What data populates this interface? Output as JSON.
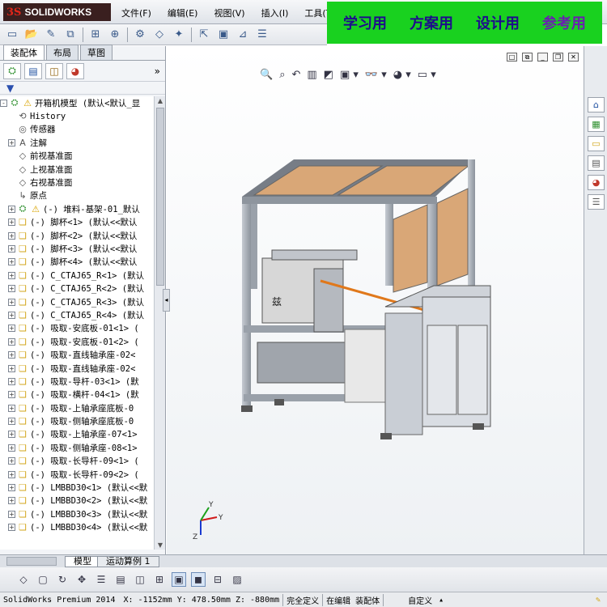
{
  "app": {
    "brand_mark": "3S",
    "brand_name": "SOLIDWORKS"
  },
  "menu": [
    "文件(F)",
    "编辑(E)",
    "视图(V)",
    "插入(I)",
    "工具(T)"
  ],
  "promo": [
    "学习用",
    "方案用",
    "设计用",
    "参考用"
  ],
  "panel_tabs": [
    "装配体",
    "布局",
    "草图"
  ],
  "panel_more": "»",
  "filter_icon": "▼",
  "tree": [
    {
      "label": "开箱机模型  (默认<默认_显",
      "icon": "asm-warn",
      "exp": "-"
    },
    {
      "label": "History",
      "icon": "history",
      "exp": ""
    },
    {
      "label": "传感器",
      "icon": "sensor",
      "exp": ""
    },
    {
      "label": "注解",
      "icon": "annotation",
      "exp": "+"
    },
    {
      "label": "前视基准面",
      "icon": "plane",
      "exp": ""
    },
    {
      "label": "上视基准面",
      "icon": "plane",
      "exp": ""
    },
    {
      "label": "右视基准面",
      "icon": "plane",
      "exp": ""
    },
    {
      "label": "原点",
      "icon": "origin",
      "exp": ""
    },
    {
      "label": "(-) 堆料-基架-01_默认",
      "icon": "asm-warn",
      "exp": "+"
    },
    {
      "label": "(-) 脚杯<1> (默认<<默认",
      "icon": "part",
      "exp": "+"
    },
    {
      "label": "(-) 脚杯<2> (默认<<默认",
      "icon": "part",
      "exp": "+"
    },
    {
      "label": "(-) 脚杯<3> (默认<<默认",
      "icon": "part",
      "exp": "+"
    },
    {
      "label": "(-) 脚杯<4> (默认<<默认",
      "icon": "part",
      "exp": "+"
    },
    {
      "label": "(-) C_CTAJ65_R<1> (默认",
      "icon": "part",
      "exp": "+"
    },
    {
      "label": "(-) C_CTAJ65_R<2> (默认",
      "icon": "part",
      "exp": "+"
    },
    {
      "label": "(-) C_CTAJ65_R<3> (默认",
      "icon": "part",
      "exp": "+"
    },
    {
      "label": "(-) C_CTAJ65_R<4> (默认",
      "icon": "part",
      "exp": "+"
    },
    {
      "label": "(-) 吸取-安底板-01<1> (",
      "icon": "part",
      "exp": "+"
    },
    {
      "label": "(-) 吸取-安底板-01<2> (",
      "icon": "part",
      "exp": "+"
    },
    {
      "label": "(-) 吸取-直线轴承座-02<",
      "icon": "part",
      "exp": "+"
    },
    {
      "label": "(-) 吸取-直线轴承座-02<",
      "icon": "part",
      "exp": "+"
    },
    {
      "label": "(-) 吸取-导杆-03<1> (默",
      "icon": "part",
      "exp": "+"
    },
    {
      "label": "(-) 吸取-横杆-04<1> (默",
      "icon": "part",
      "exp": "+"
    },
    {
      "label": "(-) 吸取-上轴承座底板-0",
      "icon": "part",
      "exp": "+"
    },
    {
      "label": "(-) 吸取-侧轴承座底板-0",
      "icon": "part",
      "exp": "+"
    },
    {
      "label": "(-) 吸取-上轴承座-07<1>",
      "icon": "part",
      "exp": "+"
    },
    {
      "label": "(-) 吸取-侧轴承座-08<1>",
      "icon": "part",
      "exp": "+"
    },
    {
      "label": "(-) 吸取-长导杆-09<1> (",
      "icon": "part",
      "exp": "+"
    },
    {
      "label": "(-) 吸取-长导杆-09<2> (",
      "icon": "part",
      "exp": "+"
    },
    {
      "label": "(-) LMBBD30<1> (默认<<默",
      "icon": "part",
      "exp": "+"
    },
    {
      "label": "(-) LMBBD30<2> (默认<<默",
      "icon": "part",
      "exp": "+"
    },
    {
      "label": "(-) LMBBD30<3> (默认<<默",
      "icon": "part",
      "exp": "+"
    },
    {
      "label": "(-) LMBBD30<4> (默认<<默",
      "icon": "part",
      "exp": "+"
    }
  ],
  "bottom_tabs": [
    "模型",
    "运动算例 1"
  ],
  "status": {
    "product": "SolidWorks Premium 2014",
    "coords": "X: -1152mm Y: 478.50mm Z: -880mm",
    "define_state": "完全定义",
    "edit_state": "在编辑 装配体",
    "units": "自定义"
  },
  "colors": {
    "promo_bg": "#19d11f",
    "promo_text": "#1e0c8c",
    "brand_bg": "#3a1f1f",
    "accent_red": "#e2261a",
    "panel_wood": "#d9a777"
  }
}
